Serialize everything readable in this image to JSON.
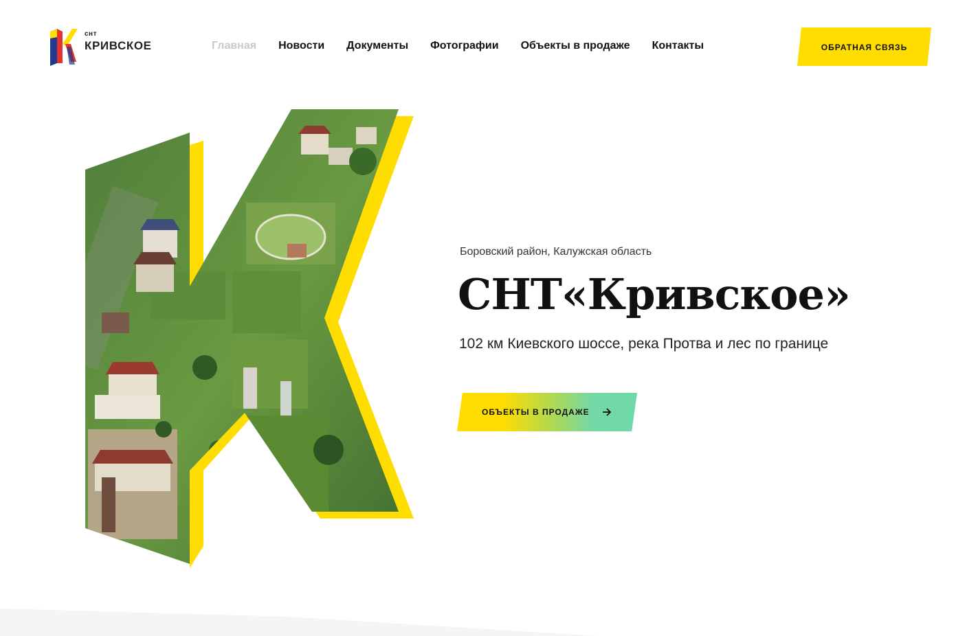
{
  "header": {
    "logo": {
      "small": "снт",
      "name": "КРИВСКОЕ"
    },
    "nav": [
      {
        "label": "Главная",
        "active": true
      },
      {
        "label": "Новости",
        "active": false
      },
      {
        "label": "Документы",
        "active": false
      },
      {
        "label": "Фотографии",
        "active": false
      },
      {
        "label": "Объекты в продаже",
        "active": false
      },
      {
        "label": "Контакты",
        "active": false
      }
    ],
    "feedback_label": "ОБРАТНАЯ СВЯЗЬ"
  },
  "hero": {
    "location": "Боровский район, Калужская область",
    "title": "СНТ«Кривское»",
    "subtitle": "102 км Киевского шоссе, река Протва и лес по границе",
    "cta_label": "ОБЪЕКТЫ В ПРОДАЖЕ",
    "cta_icon": "arrow-right-icon",
    "image": "aerial-village-k-letter"
  },
  "colors": {
    "accent": "#ffdd00",
    "gradient_end": "#6dd8a8",
    "text": "#111111",
    "nav_active": "#c9c9c9",
    "footer_band": "#f5f5f5"
  }
}
